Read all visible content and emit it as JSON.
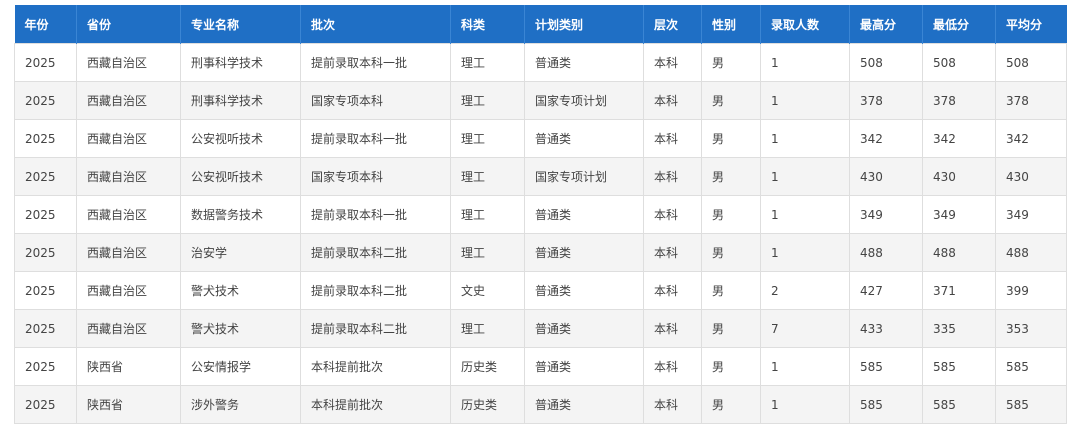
{
  "table": {
    "headers": [
      "年份",
      "省份",
      "专业名称",
      "批次",
      "科类",
      "计划类别",
      "层次",
      "性别",
      "录取人数",
      "最高分",
      "最低分",
      "平均分"
    ],
    "rows": [
      [
        "2025",
        "西藏自治区",
        "刑事科学技术",
        "提前录取本科一批",
        "理工",
        "普通类",
        "本科",
        "男",
        "1",
        "508",
        "508",
        "508"
      ],
      [
        "2025",
        "西藏自治区",
        "刑事科学技术",
        "国家专项本科",
        "理工",
        "国家专项计划",
        "本科",
        "男",
        "1",
        "378",
        "378",
        "378"
      ],
      [
        "2025",
        "西藏自治区",
        "公安视听技术",
        "提前录取本科一批",
        "理工",
        "普通类",
        "本科",
        "男",
        "1",
        "342",
        "342",
        "342"
      ],
      [
        "2025",
        "西藏自治区",
        "公安视听技术",
        "国家专项本科",
        "理工",
        "国家专项计划",
        "本科",
        "男",
        "1",
        "430",
        "430",
        "430"
      ],
      [
        "2025",
        "西藏自治区",
        "数据警务技术",
        "提前录取本科一批",
        "理工",
        "普通类",
        "本科",
        "男",
        "1",
        "349",
        "349",
        "349"
      ],
      [
        "2025",
        "西藏自治区",
        "治安学",
        "提前录取本科二批",
        "理工",
        "普通类",
        "本科",
        "男",
        "1",
        "488",
        "488",
        "488"
      ],
      [
        "2025",
        "西藏自治区",
        "警犬技术",
        "提前录取本科二批",
        "文史",
        "普通类",
        "本科",
        "男",
        "2",
        "427",
        "371",
        "399"
      ],
      [
        "2025",
        "西藏自治区",
        "警犬技术",
        "提前录取本科二批",
        "理工",
        "普通类",
        "本科",
        "男",
        "7",
        "433",
        "335",
        "353"
      ],
      [
        "2025",
        "陕西省",
        "公安情报学",
        "本科提前批次",
        "历史类",
        "普通类",
        "本科",
        "男",
        "1",
        "585",
        "585",
        "585"
      ],
      [
        "2025",
        "陕西省",
        "涉外警务",
        "本科提前批次",
        "历史类",
        "普通类",
        "本科",
        "男",
        "1",
        "585",
        "585",
        "585"
      ]
    ]
  }
}
